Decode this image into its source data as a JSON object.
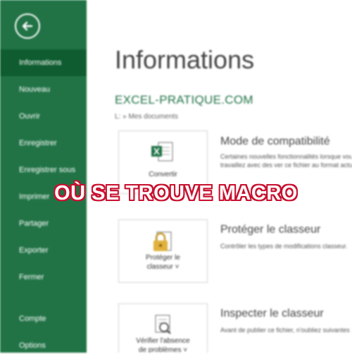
{
  "sidebar": {
    "back_icon": "back-arrow-icon",
    "items": [
      {
        "label": "Informations",
        "selected": true
      },
      {
        "label": "Nouveau"
      },
      {
        "label": "Ouvrir"
      },
      {
        "label": "Enregistrer"
      },
      {
        "label": "Enregistrer sous"
      },
      {
        "label": "Imprimer"
      },
      {
        "label": "Partager"
      },
      {
        "label": "Exporter"
      },
      {
        "label": "Fermer"
      }
    ],
    "bottom_items": [
      {
        "label": "Compte"
      },
      {
        "label": "Options"
      }
    ]
  },
  "main": {
    "title": "Informations",
    "brand": "EXCEL-PRATIQUE.COM",
    "path": "L: » Mes documents",
    "sections": [
      {
        "button_label": "Convertir",
        "icon": "excel-convert-icon",
        "title": "Mode de compatibilité",
        "description": "Certaines nouvelles fonctionnalités lorsque vous travaillez avec des ver ce fichier au format actuel"
      },
      {
        "button_label_line1": "Protéger le",
        "button_label_line2": "classeur ˅",
        "icon": "lock-icon",
        "title": "Protéger le classeur",
        "description": "Contrôler les types de modifications classeur."
      },
      {
        "button_label_line1": "Vérifier l'absence",
        "button_label_line2": "de problèmes ˅",
        "icon": "inspect-document-icon",
        "title": "Inspecter le classeur",
        "description": "Avant de publier ce fichier, n'oubliez suivantes :"
      }
    ]
  },
  "overlay": {
    "caption": "OÙ SE TROUVE MACRO"
  },
  "colors": {
    "sidebar": "#217346",
    "sidebar_selected": "#0e5c2f",
    "brand": "#217346",
    "caption_outline": "#c8102e"
  }
}
